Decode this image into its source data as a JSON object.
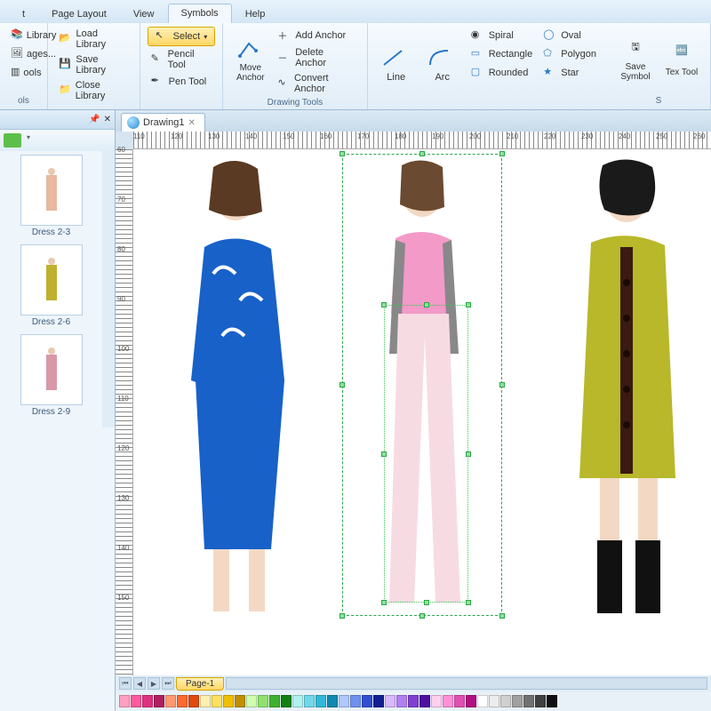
{
  "menu": {
    "items": [
      "t",
      "Page Layout",
      "View",
      "Symbols",
      "Help"
    ],
    "activeIndex": 3
  },
  "ribbon": {
    "group0": {
      "title": "ols",
      "btn1": "Library",
      "btn2": "ages...",
      "btn3": "ools"
    },
    "group1": {
      "load": "Load Library",
      "save": "Save Library",
      "close": "Close Library"
    },
    "group2": {
      "select": "Select",
      "pencil": "Pencil Tool",
      "pen": "Pen Tool"
    },
    "group3": {
      "move": "Move Anchor",
      "add": "Add Anchor",
      "del": "Delete Anchor",
      "conv": "Convert Anchor"
    },
    "group4": {
      "line": "Line",
      "arc": "Arc"
    },
    "group5": {
      "spiral": "Spiral",
      "rect": "Rectangle",
      "round": "Rounded"
    },
    "group6": {
      "oval": "Oval",
      "poly": "Polygon",
      "star": "Star"
    },
    "group7": {
      "save": "Save Symbol",
      "text": "Tex Tool"
    },
    "groupTitle": "Drawing Tools",
    "group7Title": "S"
  },
  "leftpanel": {
    "pin": "☒ ✕",
    "items": [
      {
        "label": "Dress 2-3"
      },
      {
        "label": "Dress 2-6"
      },
      {
        "label": "Dress 2-9"
      }
    ]
  },
  "tab": {
    "name": "Drawing1"
  },
  "ruler_h": [
    "110",
    "120",
    "130",
    "140",
    "150",
    "160",
    "170",
    "180",
    "190",
    "200",
    "210",
    "220",
    "230",
    "240",
    "250",
    "260"
  ],
  "ruler_v": [
    "60",
    "70",
    "80",
    "90",
    "100",
    "110",
    "120",
    "130",
    "140",
    "150"
  ],
  "page": {
    "label": "Page-1"
  },
  "palette": [
    "#ffa0c0",
    "#ff5a9e",
    "#e03080",
    "#b02060",
    "#ff9a70",
    "#ff6a30",
    "#e04a10",
    "#fff0b0",
    "#ffe060",
    "#f0c000",
    "#c09000",
    "#d0ffb0",
    "#90e070",
    "#40b030",
    "#108010",
    "#b0f0f0",
    "#70d8e8",
    "#30b8d8",
    "#1088b0",
    "#b0c8ff",
    "#7090f0",
    "#3050d0",
    "#102090",
    "#d8b8ff",
    "#b080f0",
    "#8040d0",
    "#5010a0",
    "#ffd0f0",
    "#ff90d8",
    "#e050b0",
    "#b01080",
    "#ffffff",
    "#ececec",
    "#d0d0d0",
    "#a0a0a0",
    "#707070",
    "#404040",
    "#101010"
  ]
}
